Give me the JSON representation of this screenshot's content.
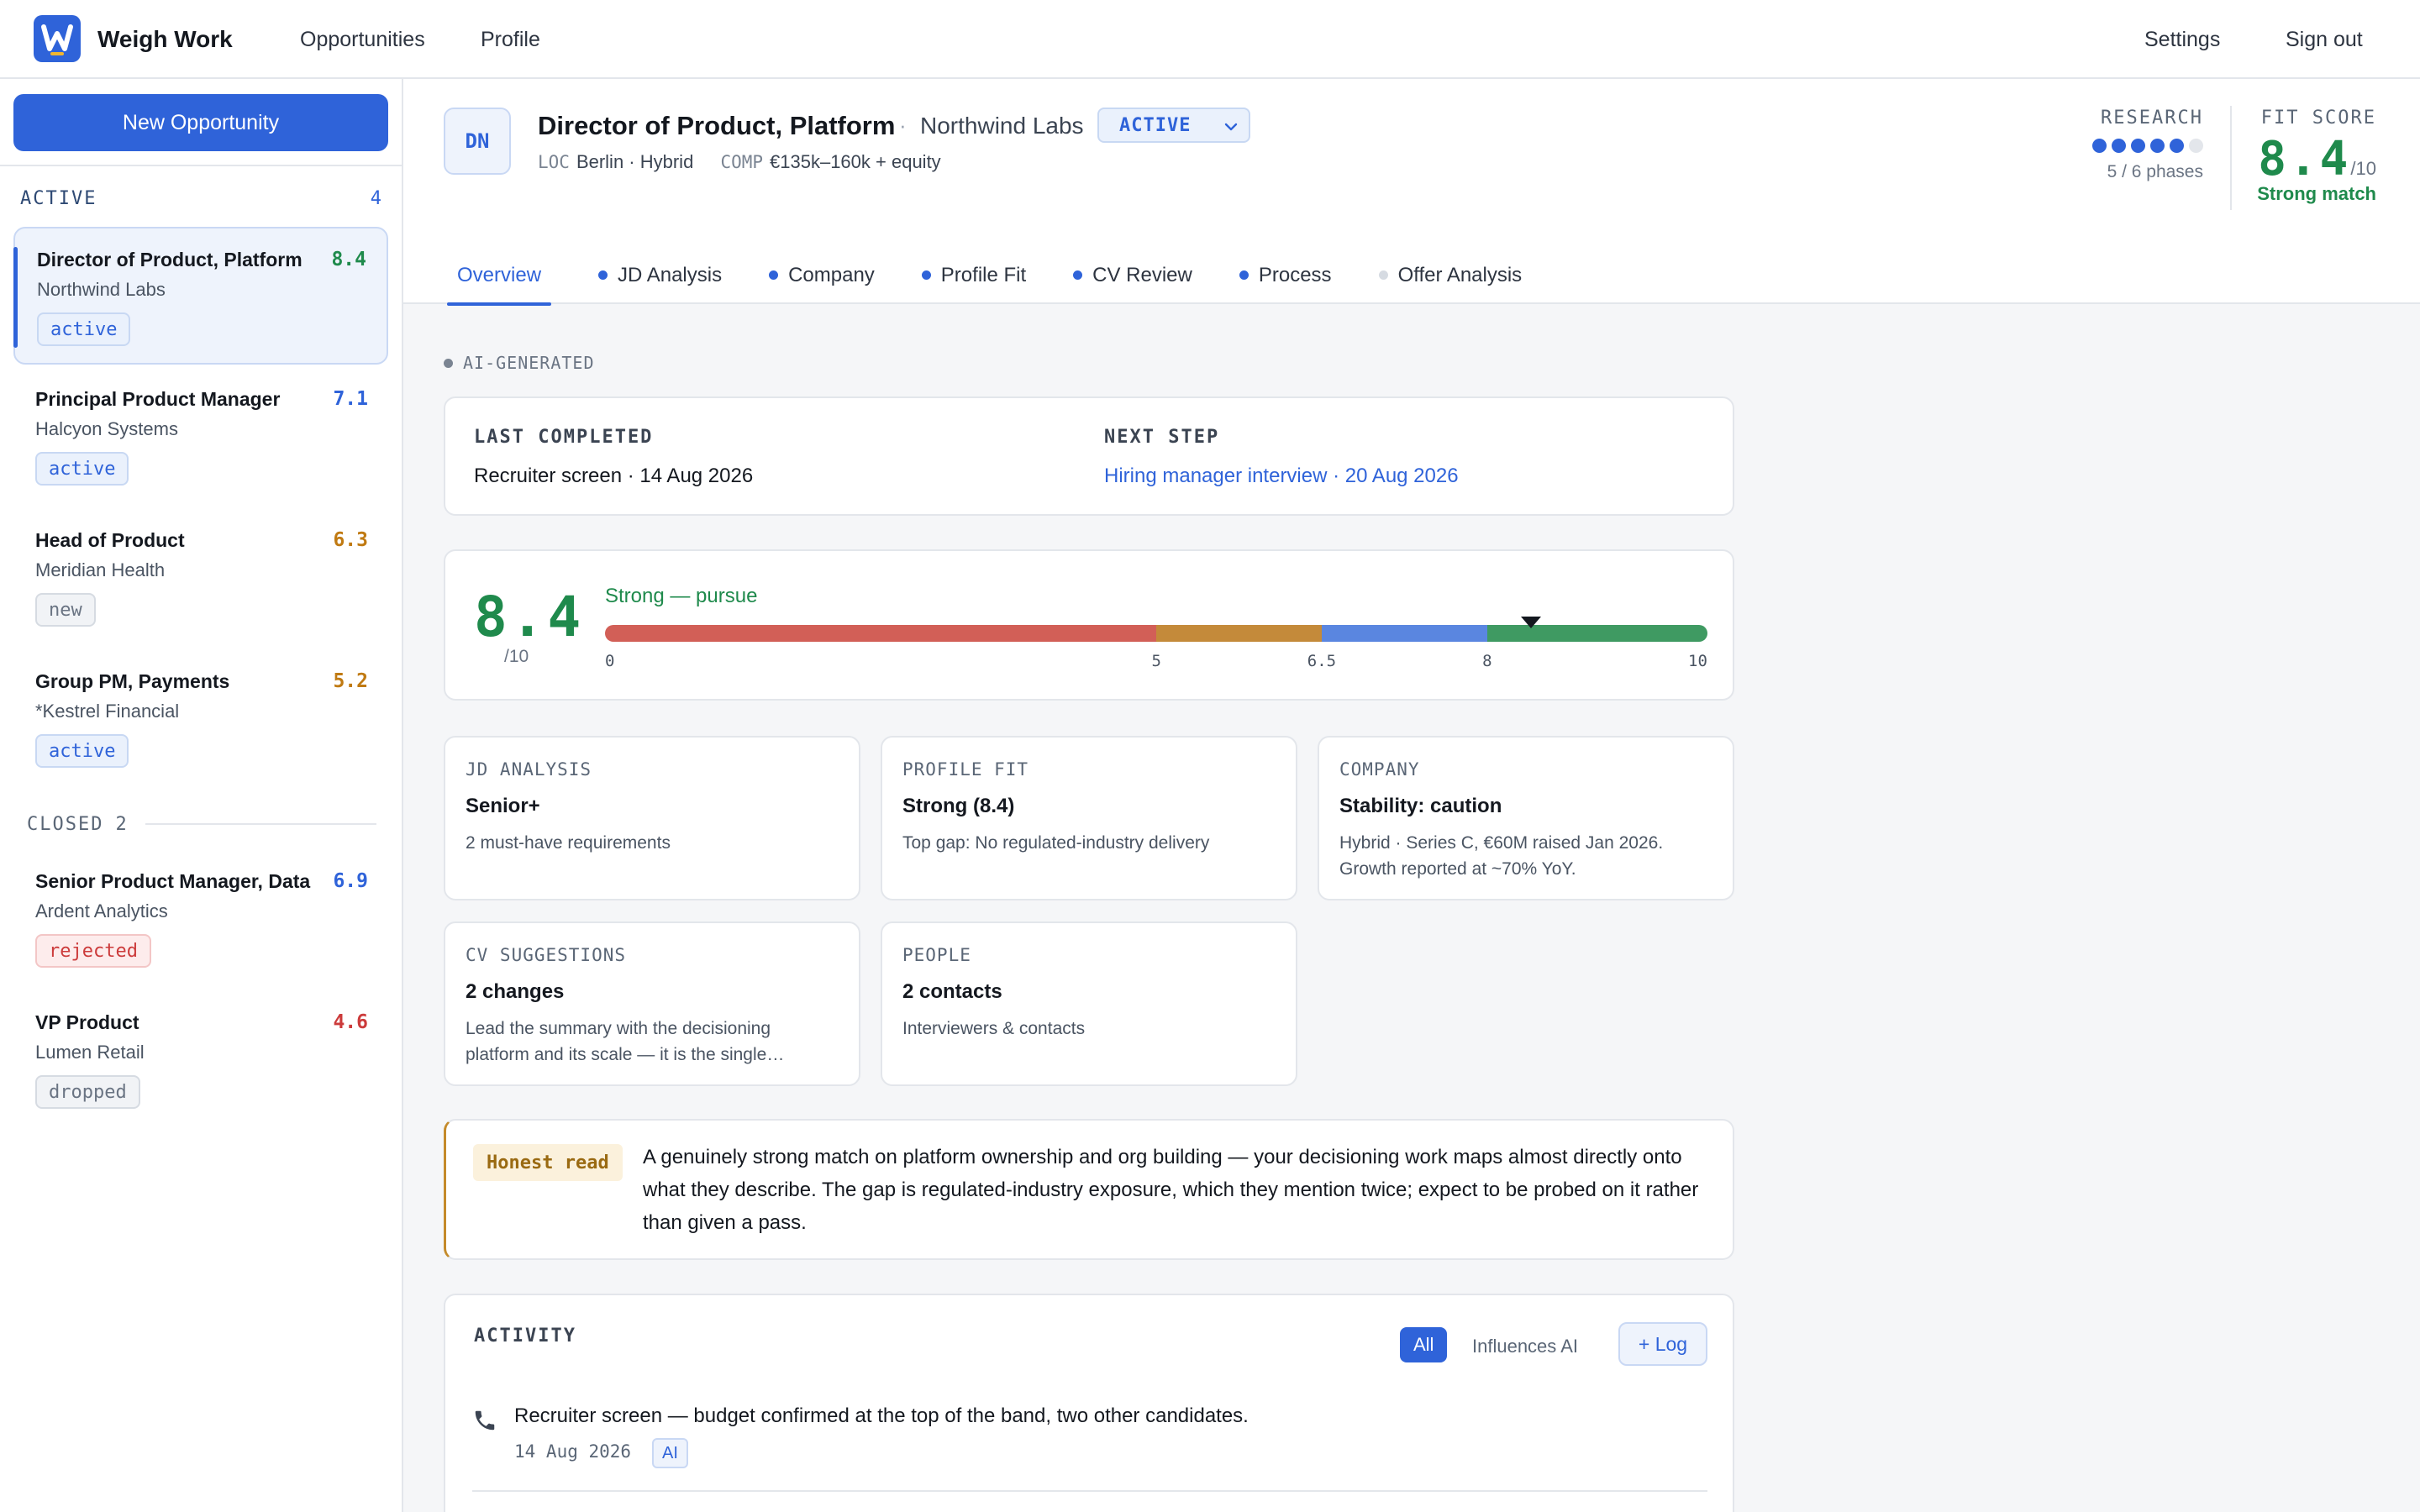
{
  "app": {
    "brand": "Weigh Work",
    "logo_icon": "w-logo-icon",
    "accent": "#2f63d9",
    "nav": [
      "Opportunities",
      "Profile"
    ],
    "settings": "Settings",
    "sign_out": "Sign out"
  },
  "sidebar": {
    "new_button": "New Opportunity",
    "active_label": "ACTIVE",
    "active_count": "4",
    "closed_label": "CLOSED",
    "closed_count": "2",
    "items": [
      {
        "title": "Director of Product, Platform",
        "company": "Northwind Labs",
        "score": "8.4",
        "status": "active",
        "score_color": "#1f8a4c"
      },
      {
        "title": "Principal Product Manager",
        "company": "Halcyon Systems",
        "score": "7.1",
        "status": "active",
        "score_color": "#2f63d9"
      },
      {
        "title": "Head of Product",
        "company": "Meridian Health",
        "score": "6.3",
        "status": "new",
        "score_color": "#c07a12"
      },
      {
        "title": "Group PM, Payments",
        "company": "*Kestrel Financial",
        "score": "5.2",
        "status": "active",
        "score_color": "#c07a12"
      },
      {
        "title": "Senior Product Manager, Data",
        "company": "Ardent Analytics",
        "score": "6.9",
        "status": "rejected",
        "score_color": "#2f63d9"
      },
      {
        "title": "VP Product",
        "company": "Lumen Retail",
        "score": "4.6",
        "status": "dropped",
        "score_color": "#cc3b3b"
      }
    ]
  },
  "header": {
    "avatar": "DN",
    "title": "Director of Product, Platform",
    "separator": "·",
    "company": "Northwind Labs",
    "status": "ACTIVE",
    "loc_key": "LOC",
    "loc_value": "Berlin · Hybrid",
    "comp_key": "COMP",
    "comp_value": "€135k–160k + equity",
    "research_label": "RESEARCH",
    "research_done": 5,
    "research_total": 6,
    "research_text": "5 / 6 phases",
    "fit_label": "FIT SCORE",
    "fit_score": "8.4",
    "fit_den": "/10",
    "fit_text": "Strong match"
  },
  "tabs": [
    {
      "label": "Overview",
      "dot": "none"
    },
    {
      "label": "JD Analysis",
      "dot": "on"
    },
    {
      "label": "Company",
      "dot": "on"
    },
    {
      "label": "Profile Fit",
      "dot": "on"
    },
    {
      "label": "CV Review",
      "dot": "on"
    },
    {
      "label": "Process",
      "dot": "on"
    },
    {
      "label": "Offer Analysis",
      "dot": "off"
    }
  ],
  "content": {
    "ai_generated": "AI-GENERATED",
    "last_completed_label": "LAST COMPLETED",
    "last_completed_value": "Recruiter screen · 14 Aug 2026",
    "next_step_label": "NEXT STEP",
    "next_step_value": "Hiring manager interview · 20 Aug 2026",
    "score": {
      "value": "8.4",
      "den": "/10",
      "verdict": "Strong — pursue",
      "marker_value": 8.4,
      "scale_min": 0,
      "scale_max": 10,
      "segments": [
        {
          "from": 0,
          "to": 5,
          "color": "#d25f57"
        },
        {
          "from": 5,
          "to": 6.5,
          "color": "#c48a3a"
        },
        {
          "from": 6.5,
          "to": 8,
          "color": "#5a86e0"
        },
        {
          "from": 8,
          "to": 10,
          "color": "#3f9a62"
        }
      ],
      "ticks": [
        {
          "label": "0",
          "value": 0
        },
        {
          "label": "5",
          "value": 5
        },
        {
          "label": "6.5",
          "value": 6.5
        },
        {
          "label": "8",
          "value": 8
        },
        {
          "label": "10",
          "value": 10
        }
      ]
    },
    "tiles": [
      {
        "label": "JD ANALYSIS",
        "value": "Senior+",
        "desc": "2 must-have requirements"
      },
      {
        "label": "PROFILE FIT",
        "value": "Strong (8.4)",
        "desc": "Top gap: No regulated-industry delivery"
      },
      {
        "label": "COMPANY",
        "value": "Stability: caution",
        "desc1": "Hybrid · Series C, €60M raised Jan 2026.",
        "desc2": "Growth reported at ~70% YoY."
      },
      {
        "label": "CV SUGGESTIONS",
        "value": "2 changes",
        "desc1": "Lead the summary with the decisioning",
        "desc2": "platform and its scale — it is the single…"
      },
      {
        "label": "PEOPLE",
        "value": "2 contacts",
        "desc": "Interviewers & contacts"
      }
    ],
    "honest_badge": "Honest read",
    "honest_text": "A genuinely strong match on platform ownership and org building — your decisioning work maps almost directly onto what they describe. The gap is regulated-industry exposure, which they mention twice; expect to be probed on it rather than given a pass.",
    "activity": {
      "label": "ACTIVITY",
      "filter_all": "All",
      "filter_ai": "Influences AI",
      "log_button": "+ Log",
      "entries": [
        {
          "icon": "phone-icon",
          "text": "Recruiter screen — budget confirmed at the top of the band, two other candidates.",
          "date": "14 Aug 2026",
          "tag": "AI"
        }
      ]
    }
  }
}
